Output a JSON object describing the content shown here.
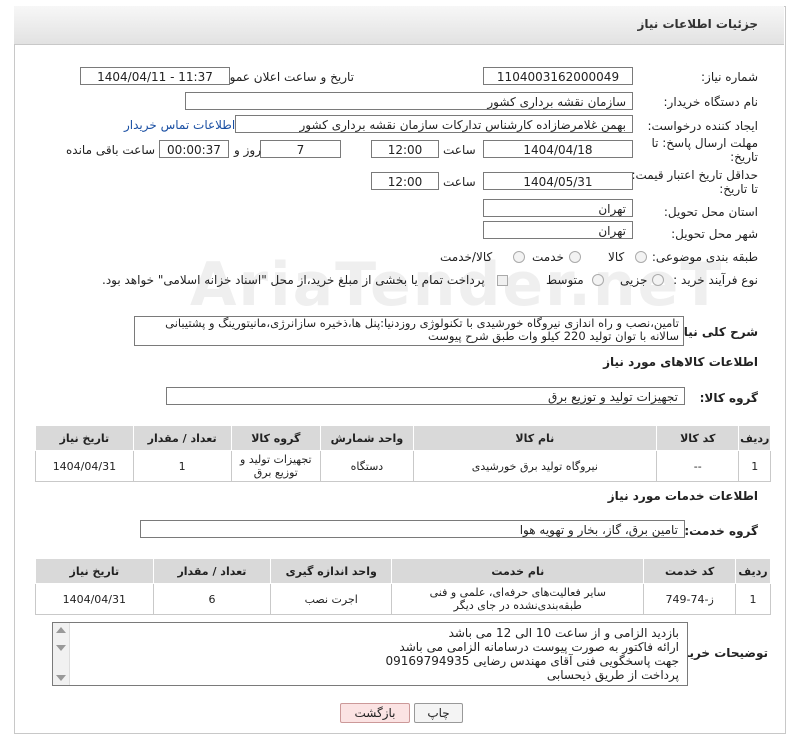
{
  "page": {
    "title": "جزئیات اطلاعات نیاز",
    "watermark": "AriaTender.neT"
  },
  "fields": {
    "need_number_label": "شماره نیاز:",
    "need_number": "1104003162000049",
    "announce_label": "تاریخ و ساعت اعلان عمومی:",
    "announce_value": "1404/04/11 - 11:37",
    "buyer_org_label": "نام دستگاه خریدار:",
    "buyer_org": "سازمان نقشه برداری کشور",
    "creator_label": "ایجاد کننده درخواست:",
    "creator": "بهمن غلامرضازاده کارشناس تدارکات  سازمان نقشه برداری کشور",
    "buyer_contact_link": "اطلاعات تماس خریدار",
    "reply_deadline_label": "مهلت ارسال پاسخ: تا تاریخ:",
    "reply_date": "1404/04/18",
    "time_label": "ساعت",
    "reply_time": "12:00",
    "days_value": "7",
    "days_label": "روز و",
    "remaining_value": "00:00:37",
    "remaining_label": "ساعت باقی مانده",
    "validity_label": "حداقل تاریخ اعتبار قیمت: تا تاریخ:",
    "validity_date": "1404/05/31",
    "validity_time": "12:00",
    "province_label": "استان محل تحویل:",
    "province": "تهران",
    "city_label": "شهر محل تحویل:",
    "city": "تهران",
    "category_label": "طبقه بندی موضوعی:",
    "category_options": [
      "کالا",
      "خدمت",
      "کالا/خدمت"
    ],
    "process_label": "نوع فرآیند خرید :",
    "process_options": [
      "جزیی",
      "متوسط"
    ],
    "payment_note": "پرداخت تمام یا بخشی از مبلغ خرید،از محل \"اسناد خزانه اسلامی\" خواهد بود.",
    "description_label": "شرح کلی نیاز:",
    "description_line1": "تامین،نصب و راه اندازی نیروگاه خورشیدی با تکنولوژی روزدنیا:پنل ها،ذخیره سازانرژی،مانیتورینگ و پشتیبانی",
    "description_line2": "سالانه با توان تولید 220 کیلو وات طبق شرح پیوست"
  },
  "goods": {
    "section_title": "اطلاعات کالاهای مورد نیاز",
    "group_label": "گروه کالا:",
    "group_value": "تجهیزات تولید و توزیع برق",
    "headers": [
      "ردیف",
      "کد کالا",
      "نام کالا",
      "واحد شمارش",
      "گروه کالا",
      "تعداد / مقدار",
      "تاریخ نیاز"
    ],
    "rows": [
      {
        "idx": "1",
        "code": "--",
        "name": "نیروگاه تولید برق خورشیدی",
        "unit": "دستگاه",
        "group": "تجهیزات تولید و توزیع برق",
        "qty": "1",
        "date": "1404/04/31"
      }
    ]
  },
  "services": {
    "section_title": "اطلاعات خدمات مورد نیاز",
    "group_label": "گروه خدمت:",
    "group_value": "تامین برق، گاز، بخار و تهویه هوا",
    "headers": [
      "ردیف",
      "کد خدمت",
      "نام خدمت",
      "واحد اندازه گیری",
      "تعداد / مقدار",
      "تاریخ نیاز"
    ],
    "rows": [
      {
        "idx": "1",
        "code": "ز-74-749",
        "name": "سایر فعالیت‌های حرفه‌ای، علمی و فنی طبقه‌بندی‌نشده در جای دیگر",
        "unit": "اجرت نصب",
        "qty": "6",
        "date": "1404/04/31"
      }
    ]
  },
  "notes": {
    "label": "توضیحات خریدار:",
    "lines": [
      "بازدید الزامی و از ساعت 10 الی 12 می باشد",
      "ارائه فاکتور به صورت پیوست درسامانه الزامی می باشد",
      "جهت پاسخگویی فنی آقای مهندس رضایی 09169794935",
      "پرداخت از طریق ذیحسابی"
    ]
  },
  "buttons": {
    "print": "چاپ",
    "back": "بازگشت"
  }
}
